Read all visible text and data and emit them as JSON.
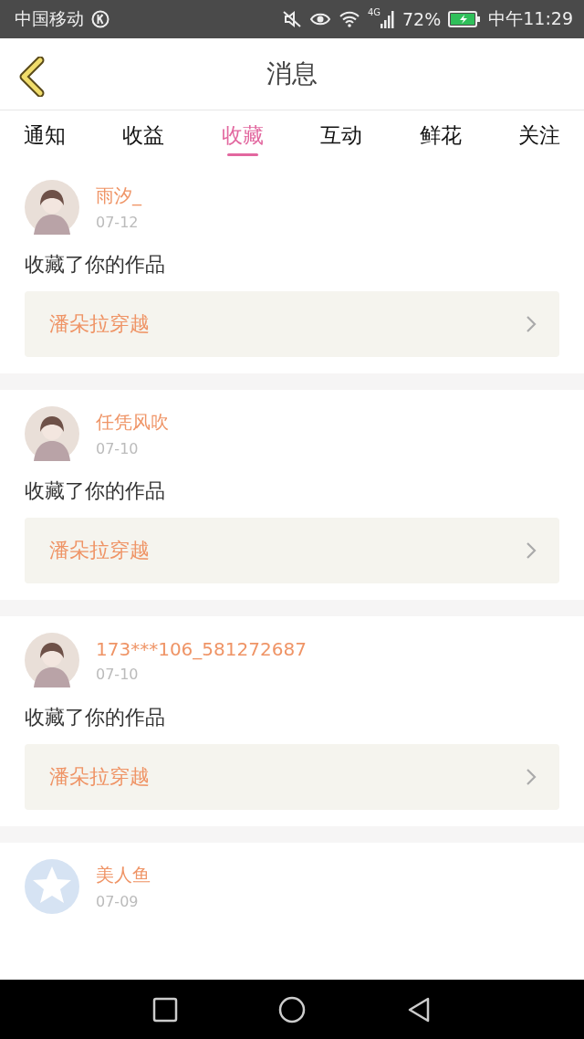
{
  "status_bar": {
    "carrier": "中国移动",
    "battery": "72%",
    "network": "4G",
    "time": "中午11:29"
  },
  "header": {
    "title": "消息"
  },
  "tabs": [
    {
      "label": "通知",
      "selected": false
    },
    {
      "label": "收益",
      "selected": false
    },
    {
      "label": "收藏",
      "selected": true
    },
    {
      "label": "互动",
      "selected": false
    },
    {
      "label": "鲜花",
      "selected": false
    },
    {
      "label": "关注",
      "selected": false
    }
  ],
  "messages": [
    {
      "kind": "figure",
      "name": "雨汐_",
      "date": "07-12",
      "text": "收藏了你的作品",
      "work": "潘朵拉穿越"
    },
    {
      "kind": "figure",
      "name": "任凭风吹",
      "date": "07-10",
      "text": "收藏了你的作品",
      "work": "潘朵拉穿越"
    },
    {
      "kind": "figure",
      "name": "173***106_581272687",
      "date": "07-10",
      "text": "收藏了你的作品",
      "work": "潘朵拉穿越"
    },
    {
      "kind": "default",
      "name": "美人鱼",
      "date": "07-09"
    }
  ]
}
